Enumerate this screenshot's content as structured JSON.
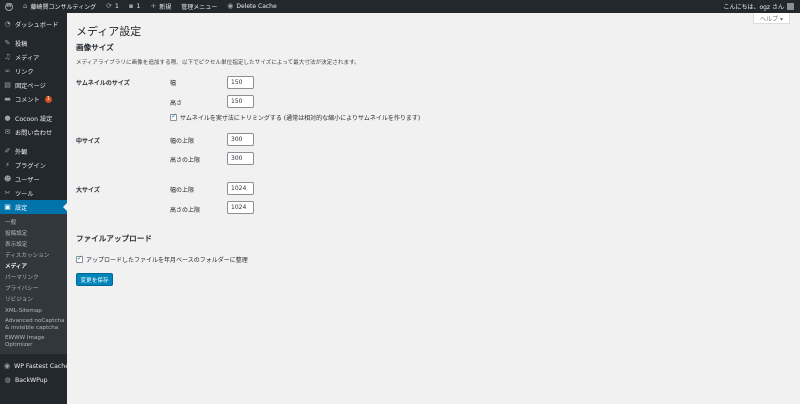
{
  "adminbar": {
    "site_name": "藤崎賢コンサルティング",
    "updates_count": "1",
    "comments_count": "1",
    "new_label": "新規",
    "admin_menu_label": "管理メニュー",
    "delete_cache_label": "Delete Cache",
    "greeting": "こんにちは、ogz さん"
  },
  "sidebar": {
    "items_top": [
      {
        "label": "ダッシュボード",
        "icon": "dashboard-icon"
      }
    ],
    "items_main": [
      {
        "label": "投稿",
        "icon": "pin-icon"
      },
      {
        "label": "メディア",
        "icon": "media-icon"
      },
      {
        "label": "リンク",
        "icon": "link-icon"
      },
      {
        "label": "固定ページ",
        "icon": "page-icon"
      },
      {
        "label": "コメント",
        "icon": "comment-icon",
        "badge": "1"
      }
    ],
    "items_plugins": [
      {
        "label": "Cocoon 設定",
        "icon": "cocoon-icon"
      },
      {
        "label": "お問い合わせ",
        "icon": "mail-icon"
      }
    ],
    "items_admin": [
      {
        "label": "外観",
        "icon": "appearance-icon"
      },
      {
        "label": "プラグイン",
        "icon": "plugin-icon"
      },
      {
        "label": "ユーザー",
        "icon": "user-icon"
      },
      {
        "label": "ツール",
        "icon": "tool-icon"
      },
      {
        "label": "設定",
        "icon": "settings-icon",
        "current": true
      }
    ],
    "submenu": [
      {
        "label": "一般"
      },
      {
        "label": "投稿設定"
      },
      {
        "label": "表示設定"
      },
      {
        "label": "ディスカッション"
      },
      {
        "label": "メディア",
        "current": true
      },
      {
        "label": "パーマリンク"
      },
      {
        "label": "プライバシー"
      },
      {
        "label": "リビジョン"
      },
      {
        "label": "XML-Sitemap"
      },
      {
        "label": "Advanced noCaptcha & invisible captcha"
      },
      {
        "label": "EWWW Image Optimizer"
      }
    ],
    "items_bottom": [
      {
        "label": "WP Fastest Cache",
        "icon": "cache-icon"
      },
      {
        "label": "BackWPup",
        "icon": "backup-icon"
      }
    ]
  },
  "help_tab": "ヘルプ ▾",
  "page_title": "メディア設定",
  "image_sizes": {
    "heading": "画像サイズ",
    "description": "メディアライブラリに画像を追加する際、以下でピクセル単位指定したサイズによって最大寸法が決定されます。",
    "thumbnail": {
      "label": "サムネイルのサイズ",
      "width_label": "幅",
      "width_value": "150",
      "height_label": "高さ",
      "height_value": "150",
      "crop_label": "サムネイルを実寸法にトリミングする (通常は相対的な縮小によりサムネイルを作ります)"
    },
    "medium": {
      "label": "中サイズ",
      "width_label": "幅の上限",
      "width_value": "300",
      "height_label": "高さの上限",
      "height_value": "300"
    },
    "large": {
      "label": "大サイズ",
      "width_label": "幅の上限",
      "width_value": "1024",
      "height_label": "高さの上限",
      "height_value": "1024"
    }
  },
  "uploads": {
    "heading": "ファイルアップロード",
    "organize_label": "アップロードしたファイルを年月ベースのフォルダーに整理"
  },
  "save_button": "変更を保存"
}
